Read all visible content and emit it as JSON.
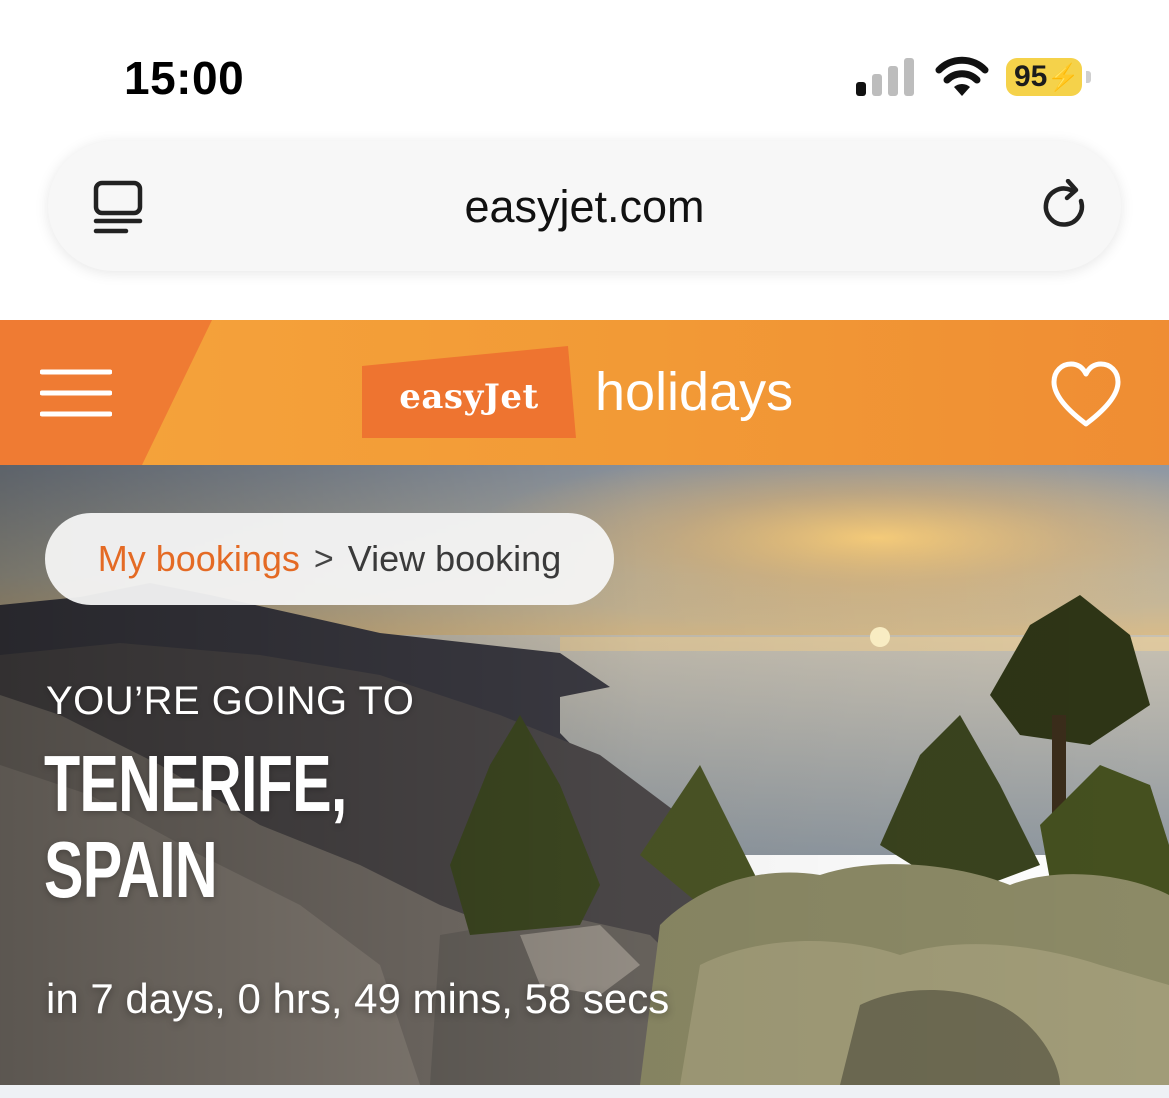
{
  "status_bar": {
    "time": "15:00",
    "battery_level": "95",
    "icons": [
      "cellular-signal-icon",
      "wifi-icon",
      "battery-charging-icon"
    ],
    "battery_color": "#f5d24a"
  },
  "browser": {
    "url": "easyjet.com",
    "icons": [
      "reader-mode-icon",
      "reload-icon"
    ]
  },
  "header": {
    "logo_text": "easyJet",
    "brand_suffix": "holidays",
    "icons": [
      "hamburger-menu-icon",
      "heart-icon"
    ],
    "colors": {
      "brand_orange": "#f29a36",
      "logo_orange": "#ee7430"
    }
  },
  "hero": {
    "breadcrumb": {
      "link_label": "My bookings",
      "separator": ">",
      "current_label": "View booking"
    },
    "eyebrow": "YOU’RE GOING TO",
    "destination_line1": "TENERIFE,",
    "destination_line2": "SPAIN",
    "countdown": "in 7 days, 0 hrs, 49 mins, 58 secs"
  }
}
